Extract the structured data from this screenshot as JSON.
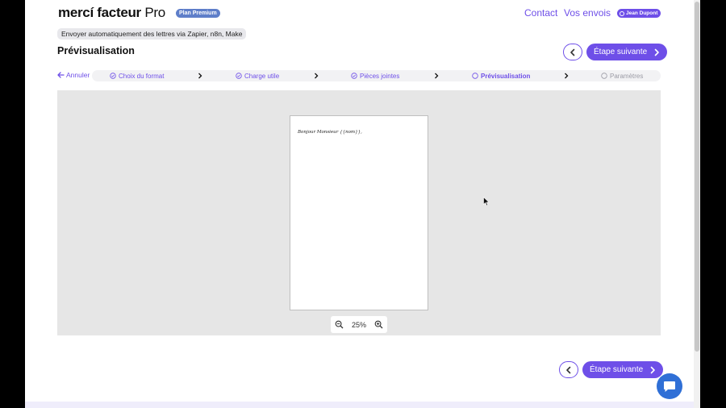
{
  "header": {
    "logo_main": "mercí facteur",
    "logo_pro": "Pro",
    "plan_badge": "Plan Premium",
    "nav": {
      "contact": "Contact",
      "vos_envois": "Vos envois"
    },
    "user_name": "Jean Dupont"
  },
  "breadcrumb": "Envoyer automatiquement des lettres via Zapier, n8n, Make",
  "page_title": "Prévisualisation",
  "buttons": {
    "next_label": "Étape suivante"
  },
  "stepper": {
    "cancel_label": "Annuler",
    "steps": [
      {
        "label": "Choix du format",
        "state": "done"
      },
      {
        "label": "Charge utile",
        "state": "done"
      },
      {
        "label": "Pièces jointes",
        "state": "done"
      },
      {
        "label": "Prévisualisation",
        "state": "active"
      },
      {
        "label": "Paramètres",
        "state": "pending"
      }
    ]
  },
  "preview": {
    "letter_text": "Bonjour Monsieur {{nom}},",
    "zoom_level": "25%"
  },
  "colors": {
    "accent": "#6e4fe8",
    "badge_blue": "#5e7ec9",
    "chat": "#2f6fd6"
  }
}
